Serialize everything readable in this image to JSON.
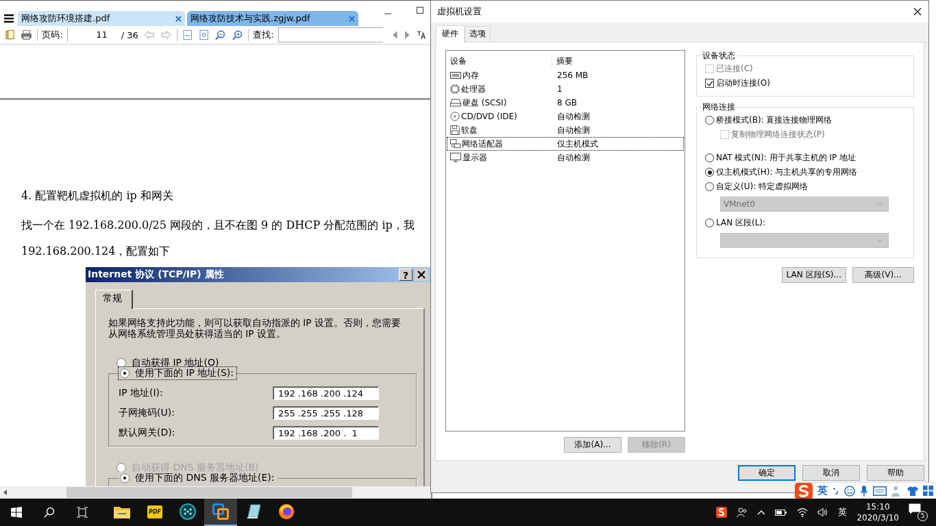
{
  "pdf_window": {
    "tabs": [
      {
        "label": "网络攻防环境搭建.pdf",
        "selected": false
      },
      {
        "label": "网络攻防技术与实践.zgjw.pdf",
        "selected": true
      }
    ],
    "toolbar": {
      "page_label": "页码:",
      "page_value": "11",
      "page_total": "/ 36",
      "find_label": "查找:"
    },
    "document": {
      "heading": "4. 配置靶机虚拟机的 ip 和网关",
      "lines": [
        "找一个在 192.168.200.0/25 网段的，且不在图 9 的 DHCP 分配范围的 ip，我",
        "192.168.200.124，配置如下"
      ],
      "figure": {
        "title": "Internet 协议 (TCP/IP) 属性",
        "help_key": "?",
        "tab": "常规",
        "intro": "如果网络支持此功能，则可以获取自动指派的 IP 设置。否则，您需要从网络系统管理员处获得适当的 IP 设置。",
        "ip_radios": [
          {
            "label": "自动获得 IP 地址(O)",
            "selected": false,
            "disabled": false
          },
          {
            "label": "使用下面的 IP 地址(S):",
            "selected": true,
            "disabled": false
          }
        ],
        "ip_fields": [
          {
            "label": "IP 地址(I):",
            "value": "192 .168 .200 .124"
          },
          {
            "label": "子网掩码(U):",
            "value": "255 .255 .255 .128"
          },
          {
            "label": "默认网关(D):",
            "value": "192 .168 .200 .  1"
          }
        ],
        "dns_radios": [
          {
            "label": "自动获得 DNS 服务器地址(B)",
            "selected": false,
            "disabled": true
          },
          {
            "label": "使用下面的 DNS 服务器地址(E):",
            "selected": true,
            "disabled": false
          }
        ]
      }
    }
  },
  "vm_dialog": {
    "title": "虚拟机设置",
    "tabs": [
      {
        "label": "硬件",
        "selected": true
      },
      {
        "label": "选项",
        "selected": false
      }
    ],
    "device_table": {
      "columns": [
        "设备",
        "摘要"
      ],
      "rows": [
        {
          "kind": "memory",
          "device": "内存",
          "summary": "256 MB",
          "selected": false
        },
        {
          "kind": "cpu",
          "device": "处理器",
          "summary": "1",
          "selected": false
        },
        {
          "kind": "disk",
          "device": "硬盘 (SCSI)",
          "summary": "8 GB",
          "selected": false
        },
        {
          "kind": "cd",
          "device": "CD/DVD (IDE)",
          "summary": "自动检测",
          "selected": false
        },
        {
          "kind": "floppy",
          "device": "软盘",
          "summary": "自动检测",
          "selected": false
        },
        {
          "kind": "network",
          "device": "网络适配器",
          "summary": "仅主机模式",
          "selected": true
        },
        {
          "kind": "display",
          "device": "显示器",
          "summary": "自动检测",
          "selected": false
        }
      ]
    },
    "device_buttons": [
      {
        "label": "添加(A)...",
        "disabled": false
      },
      {
        "label": "移除(R)",
        "disabled": true
      }
    ],
    "device_status": {
      "title": "设备状态",
      "options": [
        {
          "label": "已连接(C)",
          "checked": false,
          "disabled": true
        },
        {
          "label": "启动时连接(O)",
          "checked": true,
          "disabled": false
        }
      ]
    },
    "network": {
      "title": "网络连接",
      "options": [
        {
          "kind": "radio",
          "label": "桥接模式(B): 直接连接物理网络",
          "selected": false
        },
        {
          "kind": "checkbox",
          "label": "复制物理网络连接状态(P)",
          "checked": false,
          "disabled": true
        },
        {
          "kind": "radio",
          "label": "NAT 模式(N): 用于共享主机的 IP 地址",
          "selected": false
        },
        {
          "kind": "radio",
          "label": "仅主机模式(H): 与主机共享的专用网络",
          "selected": true
        },
        {
          "kind": "radio",
          "label": "自定义(U): 特定虚拟网络",
          "selected": false
        },
        {
          "kind": "select",
          "value": "VMnet0",
          "disabled": true
        },
        {
          "kind": "radio",
          "label": "LAN 区段(L):",
          "selected": false
        },
        {
          "kind": "select",
          "disabled": true
        }
      ]
    },
    "network_buttons": [
      {
        "label": "LAN 区段(S)..."
      },
      {
        "label": "高级(V)..."
      }
    ],
    "footer_buttons": [
      {
        "label": "确定",
        "default": true
      },
      {
        "label": "取消",
        "default": false
      },
      {
        "label": "帮助",
        "default": false
      }
    ]
  },
  "ime_bar": {
    "mode": "英"
  },
  "taskbar": {
    "apps": [
      {
        "kind": "folder",
        "active": false
      },
      {
        "kind": "pdf",
        "label": "PDF",
        "active": false
      },
      {
        "kind": "dots",
        "active": false
      },
      {
        "kind": "vmware",
        "active": true
      },
      {
        "kind": "notebook",
        "active": false
      },
      {
        "kind": "firefox",
        "active": false
      }
    ],
    "ime": "英",
    "time": "15:10",
    "date": "2020/3/10",
    "notifications": "5"
  }
}
